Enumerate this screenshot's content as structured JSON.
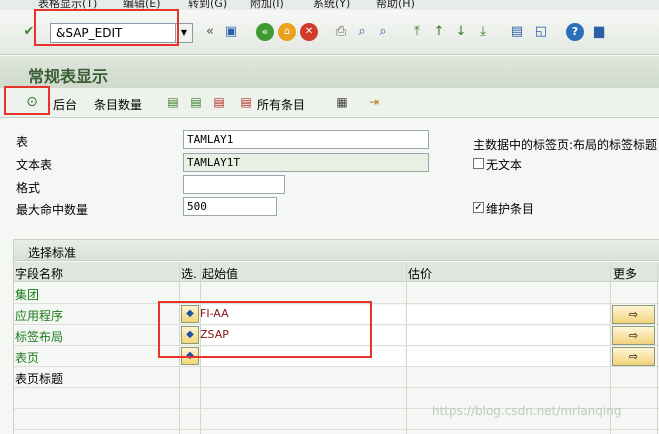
{
  "menu": [
    "表格显示(T)",
    "编辑(E)",
    "转到(G)",
    "附加(I)",
    "系统(Y)",
    "帮助(H)"
  ],
  "command_field": {
    "value": "&SAP_EDIT"
  },
  "title": "常规表显示",
  "toolbar2": {
    "background": "后台",
    "entry_count": "条目数量",
    "all_entries": "所有条目"
  },
  "form": {
    "table_label": "表",
    "table_value": "TAMLAY1",
    "text_table_label": "文本表",
    "text_table_value": "TAMLAY1T",
    "format_label": "格式",
    "format_value": "",
    "max_hits_label": "最大命中数量",
    "max_hits_value": "500",
    "master_data_label": "主数据中的标签页:布局的标签标题",
    "no_text_label": "无文本",
    "no_text_checked": false,
    "maintain_label": "维护条目",
    "maintain_checked": true
  },
  "selection": {
    "title": "选择标准",
    "columns": {
      "field": "字段名称",
      "sel": "选.",
      "from": "起始值",
      "to": "估价",
      "more": "更多"
    },
    "rows": [
      {
        "field": "集团",
        "value": "",
        "has_button": false
      },
      {
        "field": "应用程序",
        "value": "FI-AA",
        "has_button": true
      },
      {
        "field": "标签布局",
        "value": "ZSAP",
        "has_button": true
      },
      {
        "field": "表页",
        "value": "",
        "has_button": true
      },
      {
        "field": "表页标题",
        "value": "",
        "has_button": false
      }
    ]
  },
  "watermark": "https://blog.csdn.net/mrlanqing",
  "colors": {
    "title": "#3b5d36",
    "highlight": "#e8332c",
    "field_label": "#1a7a1a"
  }
}
